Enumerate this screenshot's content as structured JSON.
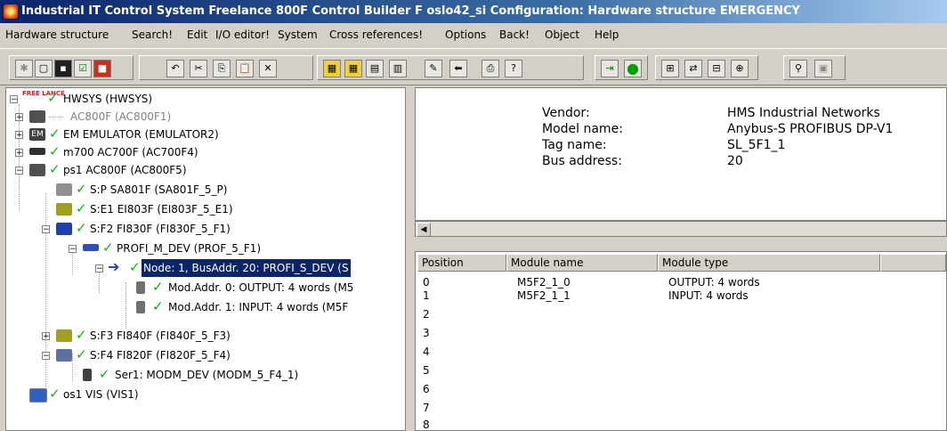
{
  "window": {
    "title": "Industrial IT Control System Freelance 800F Control Builder F oslo42_si Configuration: Hardware structure EMERGENCY"
  },
  "menu": [
    "Hardware structure",
    "Search!",
    "Edit",
    "I/O editor!",
    "System",
    "Cross references!",
    "Options",
    "Back!",
    "Object",
    "Help"
  ],
  "tree": {
    "root": {
      "badge": "FREE LANCE",
      "label": "HWSYS (HWSYS)"
    },
    "items": [
      {
        "label": "AC800F (AC800F1)"
      },
      {
        "label": "EM EMULATOR (EMULATOR2)"
      },
      {
        "label": "m700 AC700F (AC700F4)"
      },
      {
        "label": "ps1 AC800F (AC800F5)"
      },
      {
        "label": "S:P SA801F (SA801F_5_P)"
      },
      {
        "label": "S:E1 EI803F (EI803F_5_E1)"
      },
      {
        "label": "S:F2 FI830F (FI830F_5_F1)"
      },
      {
        "label": "PROFI_M_DEV (PROF_5_F1)"
      },
      {
        "label": "Node: 1, BusAddr. 20: PROFI_S_DEV (S"
      },
      {
        "label": "Mod.Addr. 0: OUTPUT: 4 words (M5"
      },
      {
        "label": "Mod.Addr. 1: INPUT: 4 words (M5F"
      },
      {
        "label": "S:F3 FI840F (FI840F_5_F3)"
      },
      {
        "label": "S:F4 FI820F (FI820F_5_F4)"
      },
      {
        "label": "Ser1: MODM_DEV (MODM_5_F4_1)"
      },
      {
        "label": "os1 VIS (VIS1)"
      }
    ]
  },
  "properties": {
    "vendor_label": "Vendor:",
    "vendor_value": "HMS Industrial Networks",
    "model_label": "Model name:",
    "model_value": "Anybus-S PROFIBUS DP-V1",
    "tag_label": "Tag name:",
    "tag_value": "SL_5F1_1",
    "bus_label": "Bus address:",
    "bus_value": "20"
  },
  "module_table": {
    "headers": [
      "Position",
      "Module name",
      "Module type"
    ],
    "positions": [
      "0",
      "1",
      "2",
      "3",
      "4",
      "5",
      "6",
      "7",
      "8"
    ],
    "rows": [
      {
        "name": "M5F2_1_0",
        "type": "OUTPUT: 4 words"
      },
      {
        "name": "M5F2_1_1",
        "type": "INPUT: 4 words"
      }
    ]
  },
  "colors": {
    "selection": "#0a246a",
    "check": "#10b010",
    "title_gradient_start": "#0a246a"
  },
  "toolbar_icons": [
    "connect-icon",
    "new-icon",
    "save-icon",
    "check-icon",
    "stop-icon",
    "undo-icon",
    "cut-icon",
    "copy-icon",
    "paste-icon",
    "delete-icon",
    "symbol1-icon",
    "symbol2-icon",
    "symbol3-icon",
    "table-icon",
    "edit-icon",
    "back-icon",
    "print-icon",
    "help-icon",
    "commission-icon",
    "status-icon",
    "io-icon",
    "station-icon",
    "network-icon",
    "bus-icon",
    "search-icon",
    "properties-icon"
  ]
}
